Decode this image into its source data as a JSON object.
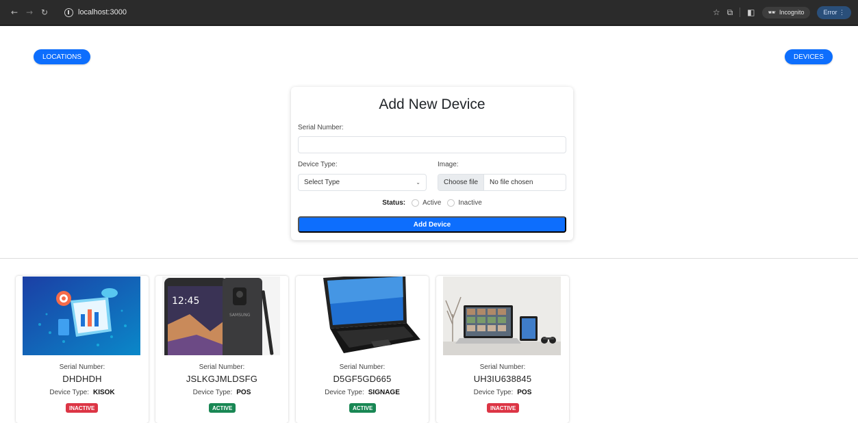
{
  "browser": {
    "url": "localhost:3000",
    "incognito_label": "Incognito",
    "error_label": "Error"
  },
  "nav": {
    "locations_label": "LOCATIONS",
    "devices_label": "DEVICES"
  },
  "form": {
    "title": "Add New Device",
    "serial_label": "Serial Number:",
    "serial_value": "",
    "device_type_label": "Device Type:",
    "device_type_selected": "Select Type",
    "image_label": "Image:",
    "file_button": "Choose file",
    "file_status": "No file chosen",
    "status_label": "Status:",
    "status_options": [
      "Active",
      "Inactive"
    ],
    "submit_label": "Add Device"
  },
  "devices": [
    {
      "serial_label": "Serial Number:",
      "serial": "DHDHDH",
      "type_label": "Device Type:",
      "type": "KISOK",
      "status": "INACTIVE",
      "status_color": "#dc3545"
    },
    {
      "serial_label": "Serial Number:",
      "serial": "JSLKGJMLDSFG",
      "type_label": "Device Type:",
      "type": "POS",
      "status": "ACTIVE",
      "status_color": "#198754"
    },
    {
      "serial_label": "Serial Number:",
      "serial": "D5GF5GD665",
      "type_label": "Device Type:",
      "type": "SIGNAGE",
      "status": "ACTIVE",
      "status_color": "#198754"
    },
    {
      "serial_label": "Serial Number:",
      "serial": "UH3IU638845",
      "type_label": "Device Type:",
      "type": "POS",
      "status": "INACTIVE",
      "status_color": "#dc3545"
    }
  ],
  "colors": {
    "primary": "#0d6efd",
    "danger": "#dc3545",
    "success": "#198754"
  }
}
